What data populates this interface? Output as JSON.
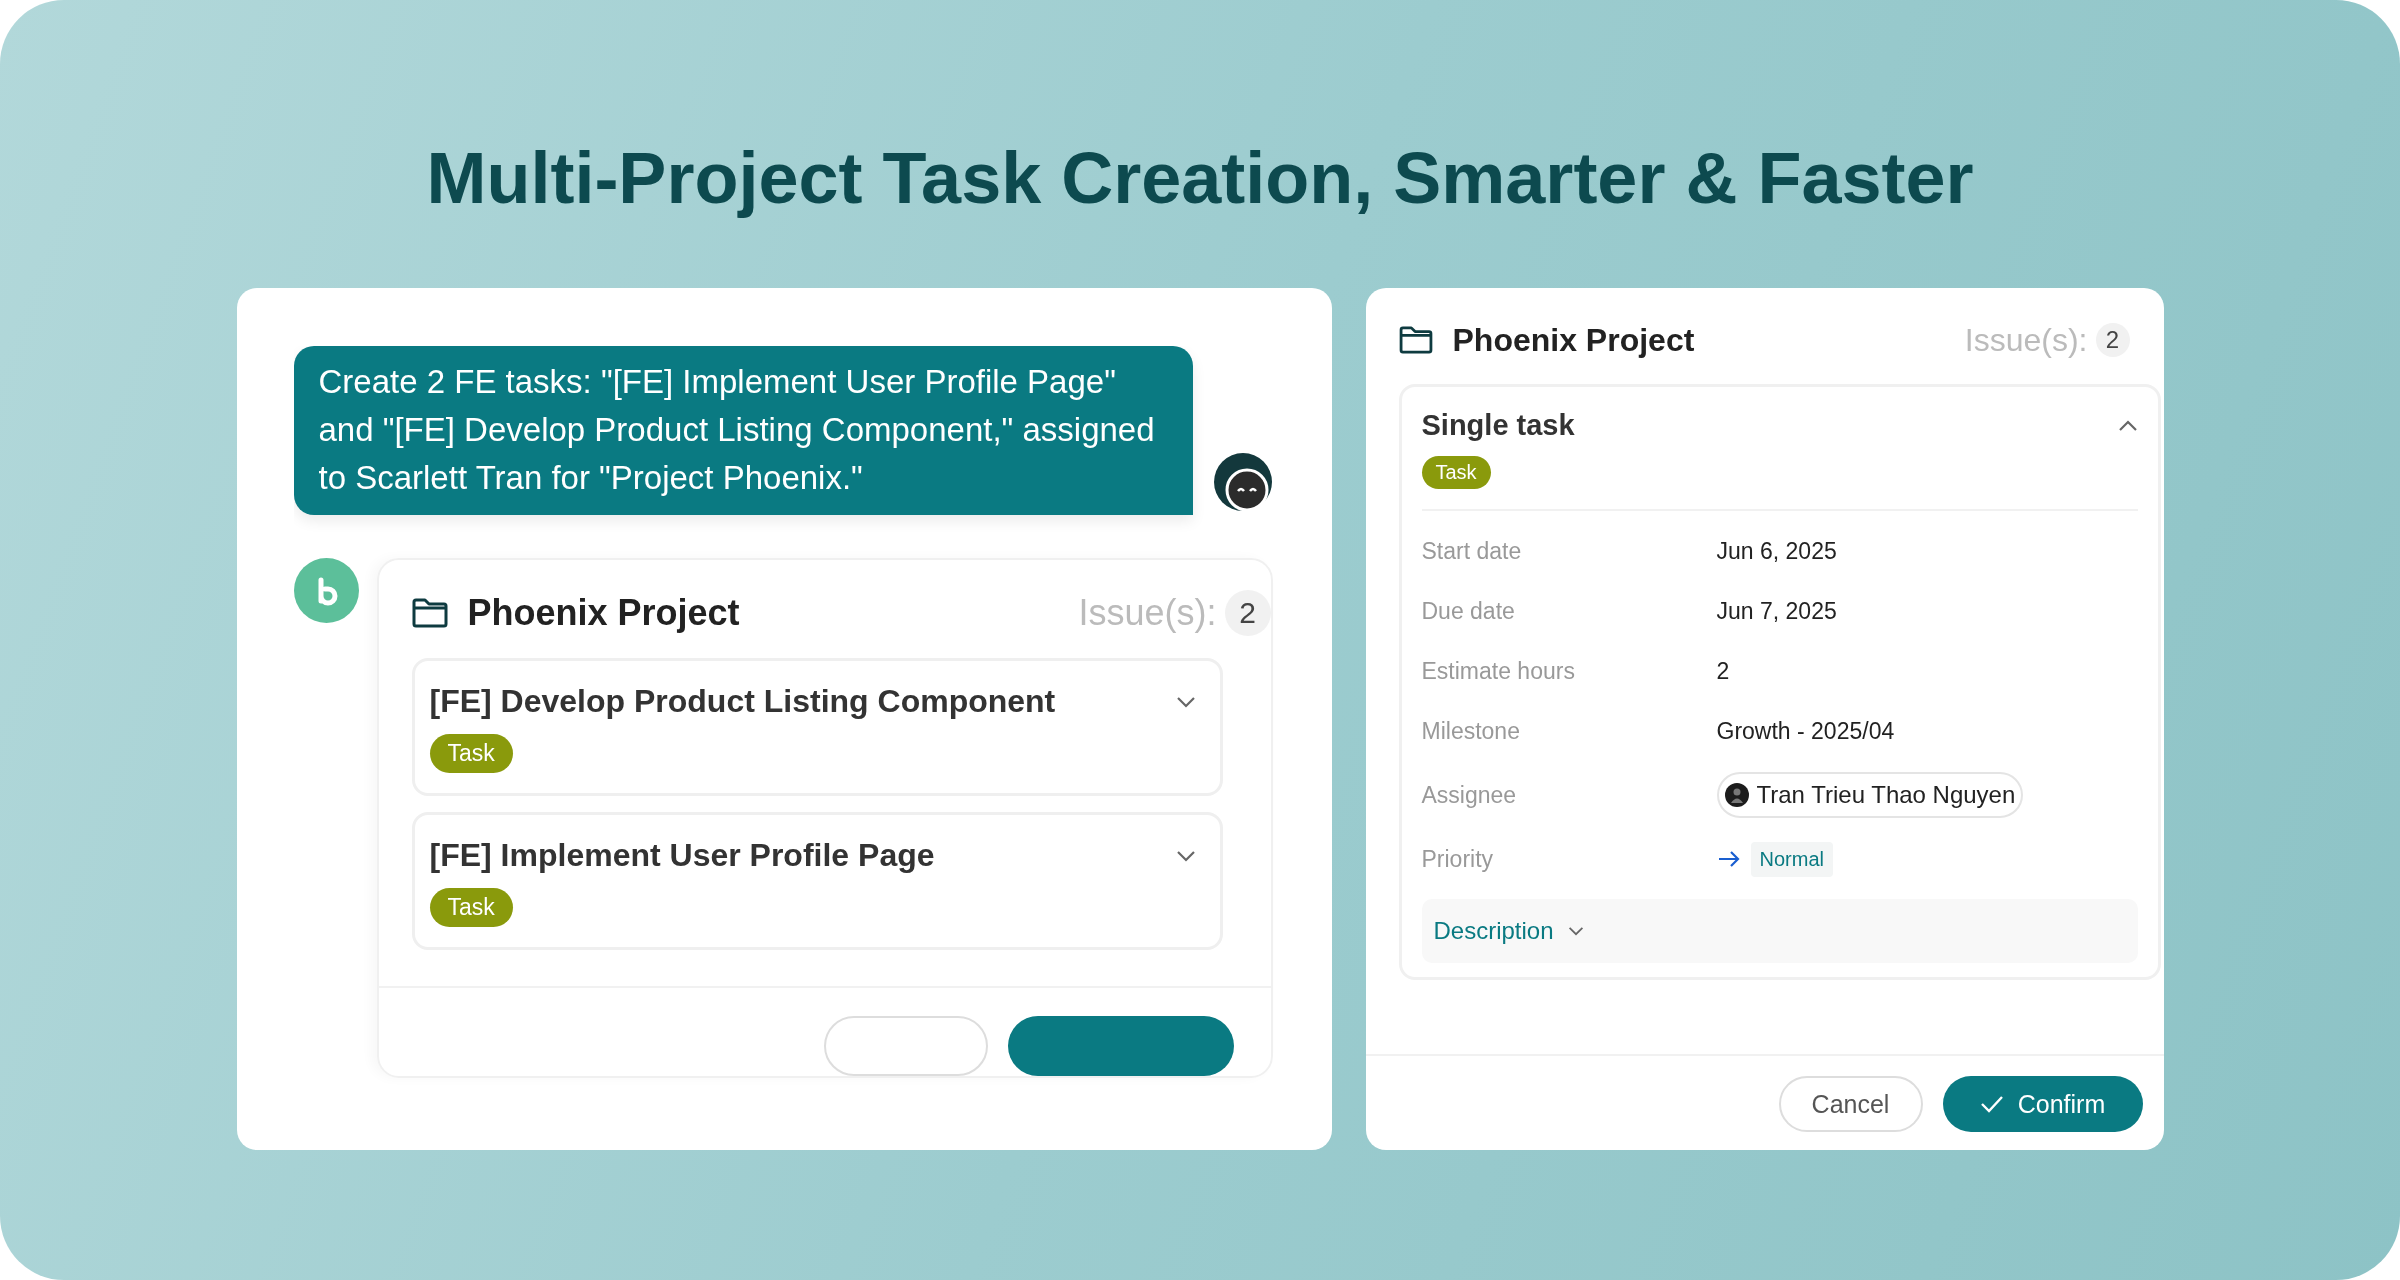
{
  "headline": "Multi-Project Task Creation, Smarter & Faster",
  "chat": {
    "message": "Create 2 FE tasks: \"[FE] Implement User Profile Page\" and \"[FE] Develop Product Listing Component,\" assigned to Scarlett Tran for \"Project Phoenix.\"",
    "project": {
      "name": "Phoenix Project",
      "issues_label": "Issue(s):",
      "issues_count": "2",
      "tasks": [
        {
          "title": "[FE] Develop Product Listing Component",
          "tag": "Task",
          "expanded": false
        },
        {
          "title": "[FE] Implement User Profile Page",
          "tag": "Task",
          "expanded": false
        }
      ],
      "buttons": [
        {
          "kind": "cancel"
        },
        {
          "kind": "confirm"
        }
      ]
    }
  },
  "detail": {
    "name": "Phoenix Project",
    "issues_label": "Issue(s):",
    "issues_count": "2",
    "task": {
      "title": "Single task",
      "tag": "Task",
      "expanded": true,
      "fields": [
        {
          "label": "Start date",
          "value": "Jun 6,  2025",
          "kind": "text"
        },
        {
          "label": "Due date",
          "value": "Jun 7,  2025",
          "kind": "text"
        },
        {
          "label": "Estimate hours",
          "value": "2",
          "kind": "text"
        },
        {
          "label": "Milestone",
          "value": "Growth - 2025/04",
          "kind": "text"
        },
        {
          "label": "Assignee",
          "value": "Tran Trieu Thao Nguyen",
          "kind": "person"
        },
        {
          "label": "Priority",
          "value": "Normal",
          "kind": "priority"
        }
      ],
      "description": {
        "label": "Description",
        "expanded": false
      }
    },
    "buttons": [
      {
        "label": "Cancel",
        "kind": "cancel"
      },
      {
        "label": "Confirm",
        "kind": "confirm"
      }
    ]
  }
}
